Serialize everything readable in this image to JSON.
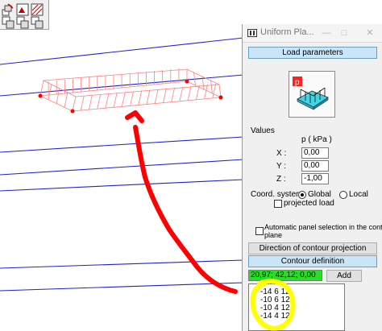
{
  "dialog": {
    "title": "Uniform Pla...",
    "load_parameters_label": "Load parameters",
    "values_label": "Values",
    "unit_header": "p   ( kPa )",
    "x_label": "X :",
    "y_label": "Y :",
    "z_label": "Z :",
    "x_value": "0,00",
    "y_value": "0,00",
    "z_value": "-1,00",
    "coord_system_label": "Coord. system:",
    "global_label": "Global",
    "local_label": "Local",
    "coord_system_selected": "Global",
    "projected_load_label": "projected load",
    "projected_load_checked": false,
    "auto_panel_label_line1": "Automatic panel selection in the contour",
    "auto_panel_label_line2": "plane",
    "auto_panel_checked": false,
    "direction_label": "Direction of contour projection",
    "contour_definition_label": "Contour definition",
    "coord_input_value": "20,97; 42,12; 0,00",
    "add_label": "Add",
    "contour_points": [
      "-14 6 12",
      "-10 6 12",
      "-10 4 12",
      "-14 4 12"
    ],
    "load_icon_letter": "p"
  },
  "colors": {
    "model_lines": "#2222cc",
    "load_outline": "#ff6b6b",
    "annotation": "#ff0000",
    "highlight": "#ffff00",
    "section_header": "#c9e5f7",
    "coord_field": "#26e026"
  },
  "icons": [
    "window-app-icon",
    "minimize-icon",
    "maximize-icon",
    "close-icon",
    "load-panel-icon",
    "toolbar-icon-1",
    "toolbar-icon-2",
    "toolbar-icon-3"
  ]
}
